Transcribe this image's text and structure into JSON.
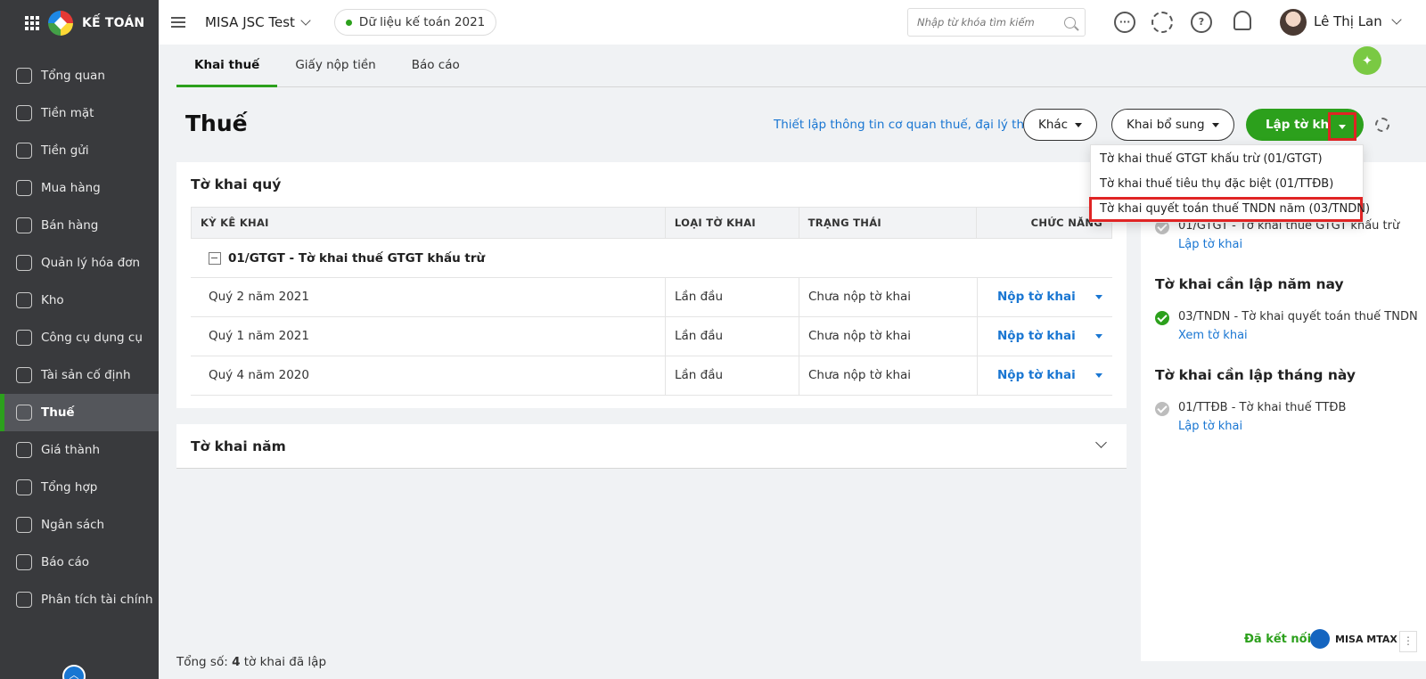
{
  "sidebar": {
    "brand": "KẾ TOÁN",
    "items": [
      {
        "label": "Tổng quan",
        "icon": "dashboard-icon"
      },
      {
        "label": "Tiền mặt",
        "icon": "money-bag-icon"
      },
      {
        "label": "Tiền gửi",
        "icon": "bank-icon"
      },
      {
        "label": "Mua hàng",
        "icon": "shopping-bag-icon"
      },
      {
        "label": "Bán hàng",
        "icon": "cart-icon"
      },
      {
        "label": "Quản lý hóa đơn",
        "icon": "invoice-icon"
      },
      {
        "label": "Kho",
        "icon": "warehouse-icon"
      },
      {
        "label": "Công cụ dụng cụ",
        "icon": "tools-icon"
      },
      {
        "label": "Tài sản cố định",
        "icon": "car-icon"
      },
      {
        "label": "Thuế",
        "icon": "tax-icon",
        "active": true
      },
      {
        "label": "Giá thành",
        "icon": "price-tag-icon"
      },
      {
        "label": "Tổng hợp",
        "icon": "ledger-icon"
      },
      {
        "label": "Ngân sách",
        "icon": "budget-icon"
      },
      {
        "label": "Báo cáo",
        "icon": "bar-chart-icon"
      },
      {
        "label": "Phân tích tài chính",
        "icon": "line-chart-icon"
      }
    ]
  },
  "topbar": {
    "company": "MISA JSC Test",
    "database": "Dữ liệu kế toán 2021",
    "search_placeholder": "Nhập từ khóa tìm kiếm",
    "user_name": "Lê Thị Lan"
  },
  "tabs": [
    {
      "label": "Khai thuế",
      "active": true
    },
    {
      "label": "Giấy nộp tiền"
    },
    {
      "label": "Báo cáo"
    }
  ],
  "header": {
    "title": "Thuế",
    "setup_link": "Thiết lập thông tin cơ quan thuế, đại lý thuế",
    "btn_other": "Khác",
    "btn_supplement": "Khai bổ sung",
    "btn_create": "Lập tờ khai"
  },
  "dropdown": {
    "items": [
      "Tờ khai thuế GTGT khấu trừ (01/GTGT)",
      "Tờ khai thuế tiêu thụ đặc biệt (01/TTĐB)",
      "Tờ khai quyết toán thuế TNDN năm (03/TNDN)"
    ]
  },
  "quarter": {
    "title": "Tờ khai quý",
    "columns": [
      "KỲ KÊ KHAI",
      "LOẠI TỜ KHAI",
      "TRẠNG THÁI",
      "CHỨC NĂNG"
    ],
    "group": "01/GTGT - Tờ khai thuế GTGT khấu trừ",
    "rows": [
      {
        "period": "Quý 2 năm 2021",
        "type": "Lần đầu",
        "status": "Chưa nộp tờ khai",
        "action": "Nộp tờ khai"
      },
      {
        "period": "Quý 1 năm 2021",
        "type": "Lần đầu",
        "status": "Chưa nộp tờ khai",
        "action": "Nộp tờ khai"
      },
      {
        "period": "Quý 4 năm 2020",
        "type": "Lần đầu",
        "status": "Chưa nộp tờ khai",
        "action": "Nộp tờ khai"
      }
    ]
  },
  "year": {
    "title": "Tờ khai năm"
  },
  "footer": {
    "total_prefix": "Tổng số:",
    "total_count": "4",
    "total_suffix": "tờ khai đã lập"
  },
  "right_panel": {
    "item_quarter": {
      "text": "01/GTGT - Tờ khai thuế GTGT khấu trừ",
      "link": "Lập tờ khai"
    },
    "section_year": "Tờ khai cần lập năm nay",
    "item_year": {
      "text": "03/TNDN - Tờ khai quyết toán thuế TNDN",
      "link": "Xem tờ khai"
    },
    "section_month": "Tờ khai cần lập tháng này",
    "item_month": {
      "text": "01/TTĐB - Tờ khai thuế TTĐB",
      "link": "Lập tờ khai"
    },
    "connected": "Đã kết nối",
    "mtax": "MISA MTAX"
  }
}
